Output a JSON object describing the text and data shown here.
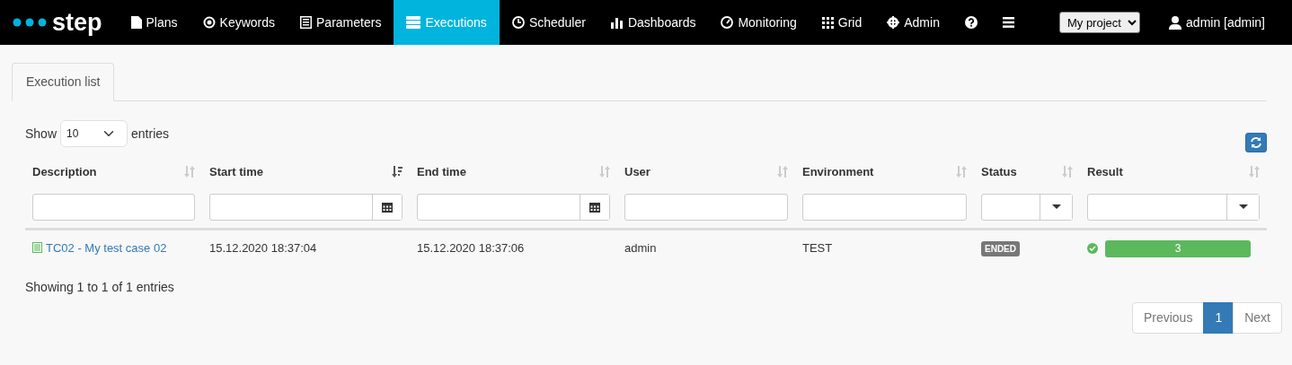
{
  "brand": "step",
  "nav": [
    {
      "label": "Plans",
      "selected": false
    },
    {
      "label": "Keywords",
      "selected": false
    },
    {
      "label": "Parameters",
      "selected": false
    },
    {
      "label": "Executions",
      "selected": true
    },
    {
      "label": "Scheduler",
      "selected": false
    },
    {
      "label": "Dashboards",
      "selected": false
    },
    {
      "label": "Monitoring",
      "selected": false
    },
    {
      "label": "Grid",
      "selected": false
    },
    {
      "label": "Admin",
      "selected": false
    }
  ],
  "project": {
    "value": "My project"
  },
  "user": "admin [admin]",
  "tabs": [
    {
      "label": "Execution list",
      "selected": true
    }
  ],
  "length": {
    "before": "Show",
    "value": "10",
    "after": "entries"
  },
  "table": {
    "columns": [
      {
        "label": "Description",
        "sorted": false,
        "kind": "text"
      },
      {
        "label": "Start time",
        "sorted": true,
        "kind": "date"
      },
      {
        "label": "End time",
        "sorted": false,
        "kind": "date"
      },
      {
        "label": "User",
        "sorted": false,
        "kind": "text"
      },
      {
        "label": "Environment",
        "sorted": false,
        "kind": "text"
      },
      {
        "label": "Status",
        "sorted": false,
        "kind": "select"
      },
      {
        "label": "Result",
        "sorted": false,
        "kind": "select"
      }
    ],
    "rows": [
      {
        "description": "TC02 - My test case 02",
        "start": "15.12.2020 18:37:04",
        "end": "15.12.2020 18:37:06",
        "user": "admin",
        "environment": "TEST",
        "status": "ENDED",
        "result": {
          "passed": true,
          "count": "3",
          "level": 1,
          "color": "#5cb85c"
        }
      }
    ]
  },
  "info": "Showing 1 to 1 of 1 entries",
  "pagination": [
    {
      "label": "Previous",
      "disabled": true,
      "selected": false
    },
    {
      "label": "1",
      "disabled": false,
      "selected": true
    },
    {
      "label": "Next",
      "disabled": true,
      "selected": false
    }
  ]
}
